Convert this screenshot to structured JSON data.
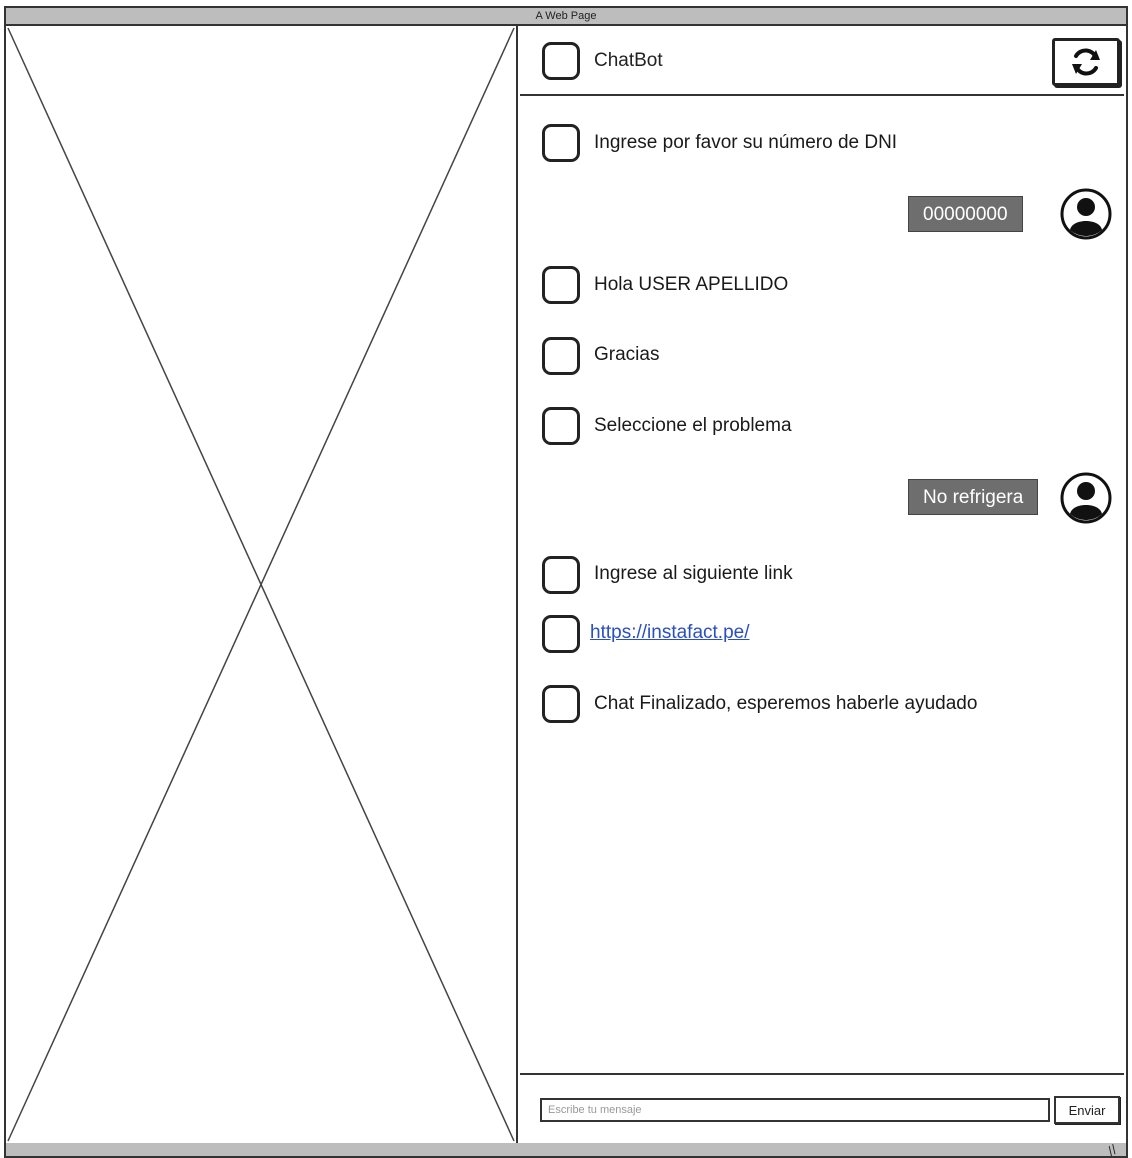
{
  "window": {
    "title": "A Web Page"
  },
  "chat": {
    "header": {
      "title": "ChatBot",
      "refresh_icon": "refresh-icon"
    },
    "messages": [
      {
        "from": "bot",
        "text": "Ingrese por favor su número de DNI"
      },
      {
        "from": "user",
        "text": "00000000"
      },
      {
        "from": "bot",
        "text": "Hola USER APELLIDO"
      },
      {
        "from": "bot",
        "text": "Gracias"
      },
      {
        "from": "bot",
        "text": "Seleccione el problema"
      },
      {
        "from": "user",
        "text": "No refrigera"
      },
      {
        "from": "bot",
        "text": "Ingrese al siguiente link"
      },
      {
        "from": "bot",
        "text": "https://instafact.pe/",
        "link": true
      },
      {
        "from": "bot",
        "text": "Chat Finalizado, esperemos haberle ayudado"
      }
    ],
    "input": {
      "placeholder": "Escribe tu mensaje",
      "value": ""
    },
    "send_label": "Enviar"
  },
  "colors": {
    "user_bubble": "#6e6e6e",
    "link": "#2a4fbf"
  }
}
